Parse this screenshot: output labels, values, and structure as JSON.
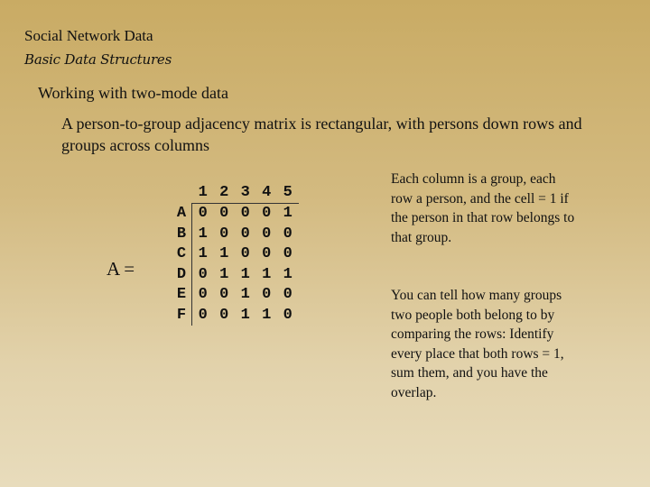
{
  "slide": {
    "title": "Social Network Data",
    "subtitle": "Basic Data Structures",
    "heading": "Working with two-mode data",
    "description": "A person-to-group adjacency matrix is rectangular, with persons down rows and groups across columns",
    "matrix_label": "A ="
  },
  "matrix": {
    "columns": [
      "1",
      "2",
      "3",
      "4",
      "5"
    ],
    "rows": [
      {
        "label": "A",
        "values": [
          "0",
          "0",
          "0",
          "0",
          "1"
        ]
      },
      {
        "label": "B",
        "values": [
          "1",
          "0",
          "0",
          "0",
          "0"
        ]
      },
      {
        "label": "C",
        "values": [
          "1",
          "1",
          "0",
          "0",
          "0"
        ]
      },
      {
        "label": "D",
        "values": [
          "0",
          "1",
          "1",
          "1",
          "1"
        ]
      },
      {
        "label": "E",
        "values": [
          "0",
          "0",
          "1",
          "0",
          "0"
        ]
      },
      {
        "label": "F",
        "values": [
          "0",
          "0",
          "1",
          "1",
          "0"
        ]
      }
    ]
  },
  "notes": {
    "note1": "Each column is a group, each  row a person, and the cell = 1 if the person in that row belongs to that group.",
    "note2": "You can tell how many groups two people both belong to by comparing the rows:  Identify every place that both rows = 1, sum them, and you have the overlap."
  }
}
